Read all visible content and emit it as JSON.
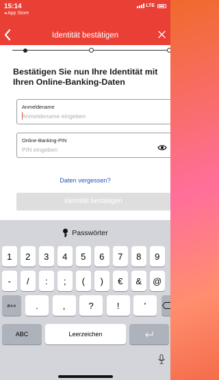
{
  "status": {
    "time": "15:14",
    "back_app": "◂ App Store",
    "network": "LTE"
  },
  "nav": {
    "title": "Identität bestätigen",
    "back_icon": "chevron-left-icon",
    "close_icon": "close-icon"
  },
  "progress": {
    "current_step": 1
  },
  "main": {
    "heading": "Bestätigen Sie nun Ihre Identität mit Ihren Online-Banking-Daten",
    "username": {
      "label": "Anmeldename",
      "placeholder": "Anmeldename eingeben"
    },
    "pin": {
      "label": "Online-Banking-PIN",
      "placeholder": "PIN eingeben"
    },
    "forgot_link": "Daten vergessen?",
    "submit_label": "Identität bestätigen"
  },
  "keyboard": {
    "toolbar_label": "Passwörter",
    "row1": [
      "1",
      "2",
      "3",
      "4",
      "5",
      "6",
      "7",
      "8",
      "9"
    ],
    "row2": [
      "-",
      "/",
      ":",
      ";",
      "(",
      ")",
      "€",
      "&",
      "@"
    ],
    "row3": {
      "mode": "#+=",
      "keys": [
        ".",
        ",",
        "?",
        "!",
        "'"
      ]
    },
    "abc": "ABC",
    "space": "Leerzeichen",
    "return_icon": "return-icon",
    "delete_icon": "delete-icon",
    "mic_icon": "microphone-icon"
  },
  "colors": {
    "brand_red": "#ea3f35",
    "link_blue": "#2e4fb6"
  }
}
